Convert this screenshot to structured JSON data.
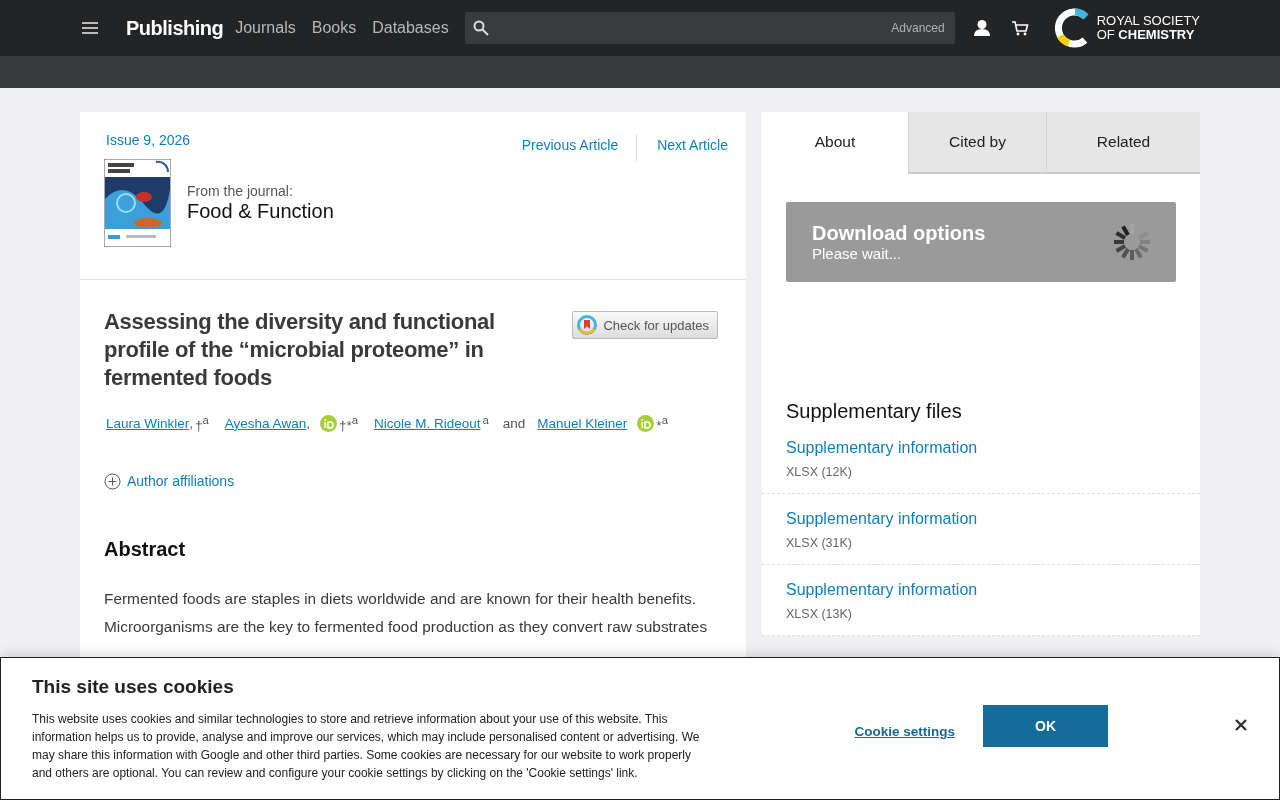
{
  "header": {
    "brand": "Publishing",
    "nav": [
      "Journals",
      "Books",
      "Databases"
    ],
    "search": {
      "advanced": "Advanced"
    },
    "logo": {
      "line1": "ROYAL SOCIETY",
      "line2": "OF **CHEMISTRY**"
    }
  },
  "article": {
    "issue": "Issue 9, 2026",
    "nav": [
      "Previous Article",
      "Next Article"
    ],
    "journal": {
      "label": "From the journal:",
      "name": "Food & Function"
    },
    "title": "Assessing the diversity and functional profile of the “microbial proteome” in fermented foods",
    "check_updates": "Check for updates",
    "authors": [
      {
        "name": "Laura Winkler",
        "sep": ",",
        "orcid": false,
        "marks": "†$^{a}$"
      },
      {
        "name": "Ayesha Awan",
        "sep": ",",
        "orcid": true,
        "marks": "†*$^{a}$"
      },
      {
        "name": "Nicole M. Rideout",
        "orcid": false,
        "marks": "$^{a}$"
      },
      {
        "name": "Manuel Kleiner",
        "orcid": true,
        "marks": "*$^{a}$"
      }
    ],
    "and": "and",
    "affiliations": "Author affiliations",
    "abstract": {
      "heading": "Abstract",
      "text": "Fermented foods are staples in diets worldwide and are known for their health benefits. Microorganisms are the key to fermented food production as they convert raw substrates"
    }
  },
  "sidebar": {
    "tabs": [
      {
        "label": "About",
        "selected": true
      },
      {
        "label": "Cited by",
        "selected": false
      },
      {
        "label": "Related",
        "selected": false
      }
    ],
    "download": {
      "title": "Download options",
      "subtitle": "Please wait..."
    },
    "supplementary": {
      "heading": "Supplementary files",
      "files": [
        {
          "label": "Supplementary information",
          "size": "XLSX (12K)"
        },
        {
          "label": "Supplementary information",
          "size": "XLSX (31K)"
        },
        {
          "label": "Supplementary information",
          "size": "XLSX (13K)"
        }
      ]
    }
  },
  "cookie": {
    "title": "This site uses cookies",
    "text": "This website uses cookies and similar technologies to store and retrieve information about your use of this website. This information helps us to provide, analyse and improve our services, which may include personalised content or advertising. We may share this information with Google and other third parties. Some cookies are necessary for our website to work properly and others are optional. You can review and configure your cookie settings by clicking on the 'Cookie settings' link.",
    "settings": "Cookie settings",
    "ok": "OK"
  }
}
